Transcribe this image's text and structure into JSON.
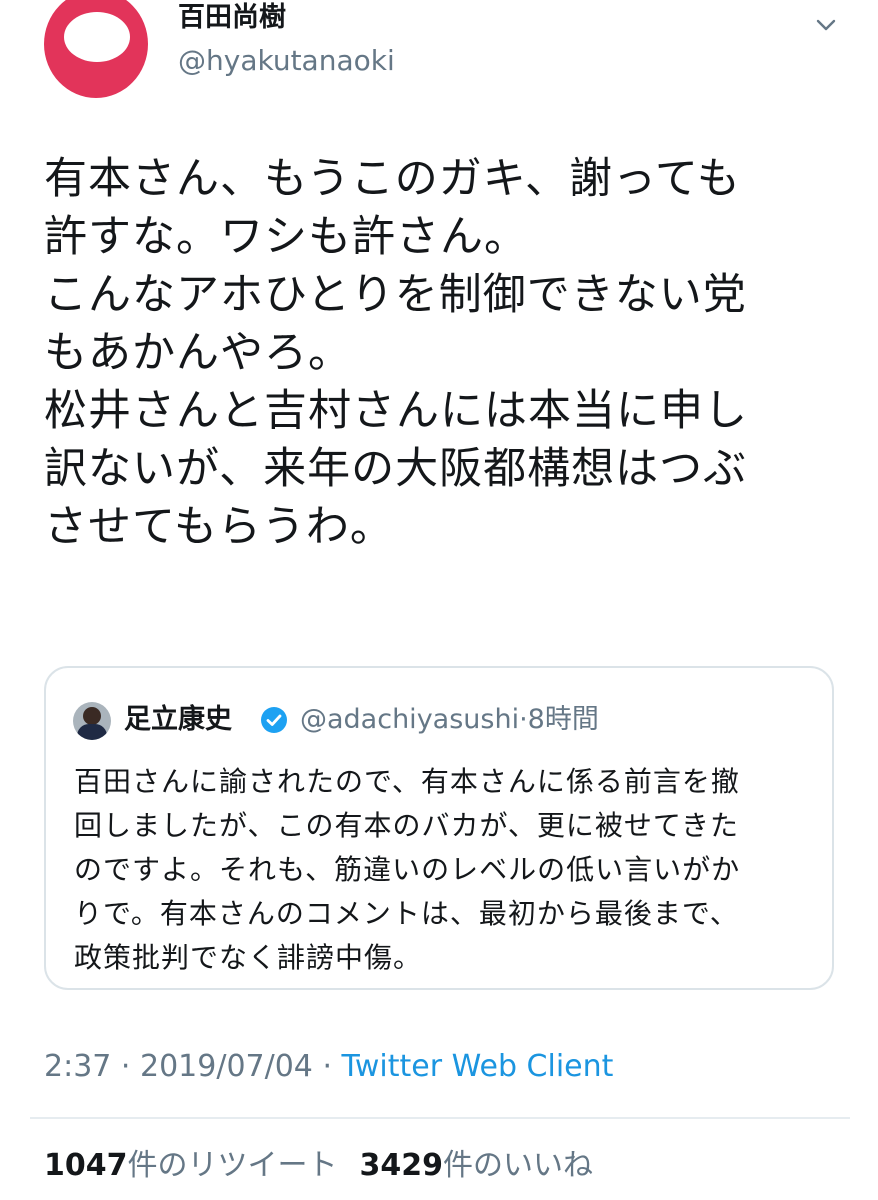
{
  "author": {
    "display_name": "百田尚樹",
    "handle": "@hyakutanaoki"
  },
  "tweet": {
    "text": "有本さん、もうこのガキ、謝っても\n許すな。ワシも許さん。\nこんなアホひとりを制御できない党\nもあかんやろ。\n松井さんと吉村さんには本当に申し\n訳ないが、来年の大阪都構想はつぶ\nさせてもらうわ。"
  },
  "quoted_tweet": {
    "display_name": "足立康史",
    "handle": "@adachiyasushi",
    "separator": "·",
    "time": "8時間",
    "text": "百田さんに諭されたので、有本さんに係る前言を撤\n回しましたが、この有本のバカが、更に被せてきた\nのですよ。それも、筋違いのレベルの低い言いがか\nりで。有本さんのコメントは、最初から最後まで、\n政策批判でなく誹謗中傷。"
  },
  "meta": {
    "time": "2:37",
    "sep1": " · ",
    "date": "2019/07/04",
    "sep2": " · ",
    "client": "Twitter Web Client"
  },
  "stats": {
    "retweet_count": "1047",
    "retweet_label": "件のリツイート",
    "like_count": "3429",
    "like_label": "件のいいね"
  },
  "icons": {
    "menu": "chevron-down-icon",
    "verified": "verified-badge-icon"
  },
  "colors": {
    "avatar": "#e2345a",
    "link": "#1b95e0",
    "secondary_text": "#657786",
    "verified": "#1da1f2"
  }
}
